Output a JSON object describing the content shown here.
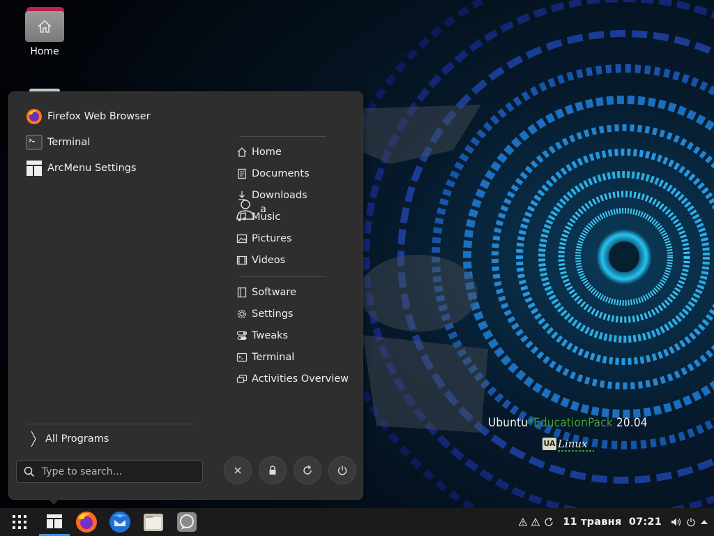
{
  "desktop": {
    "home_label": "Home",
    "brand_text_a": "Ubuntu",
    "brand_text_star": "*",
    "brand_text_b": "EducationPack",
    "brand_text_c": " 20.04",
    "logo_box": "UA",
    "logo_text": "Linux"
  },
  "menu": {
    "apps": [
      {
        "label": "Firefox Web Browser",
        "icon": "firefox-icon"
      },
      {
        "label": "Terminal",
        "icon": "terminal-icon"
      },
      {
        "label": "ArcMenu Settings",
        "icon": "arcmenu-icon"
      }
    ],
    "user_name": "a",
    "places": [
      {
        "label": "Home",
        "icon": "home-icon"
      },
      {
        "label": "Documents",
        "icon": "document-icon"
      },
      {
        "label": "Downloads",
        "icon": "download-icon"
      },
      {
        "label": "Music",
        "icon": "music-icon"
      },
      {
        "label": "Pictures",
        "icon": "picture-icon"
      },
      {
        "label": "Videos",
        "icon": "video-icon"
      }
    ],
    "shortcuts": [
      {
        "label": "Software",
        "icon": "software-icon"
      },
      {
        "label": "Settings",
        "icon": "settings-icon"
      },
      {
        "label": "Tweaks",
        "icon": "tweaks-icon"
      },
      {
        "label": "Terminal",
        "icon": "terminal-icon"
      },
      {
        "label": "Activities Overview",
        "icon": "activities-icon"
      }
    ],
    "all_programs": "All Programs",
    "search_placeholder": "Type to search...",
    "power_buttons": [
      "close-icon",
      "lock-icon",
      "restart-icon",
      "power-icon"
    ]
  },
  "taskbar": {
    "apps": [
      "app-grid-icon",
      "arcmenu-icon",
      "firefox-icon",
      "thunderbird-icon",
      "files-icon",
      "chat-icon"
    ],
    "clock_date": "11 травня",
    "clock_time": "07:21",
    "tray_icons": [
      "warning-icon",
      "warning-icon",
      "refresh-icon",
      "volume-icon",
      "power-icon",
      "arrow-up-icon"
    ]
  },
  "colors": {
    "menu_bg": "#2e2e2e",
    "taskbar_bg": "#1b1b1b",
    "accent": "#3d8ee8",
    "brand_green": "#3fa02e"
  }
}
